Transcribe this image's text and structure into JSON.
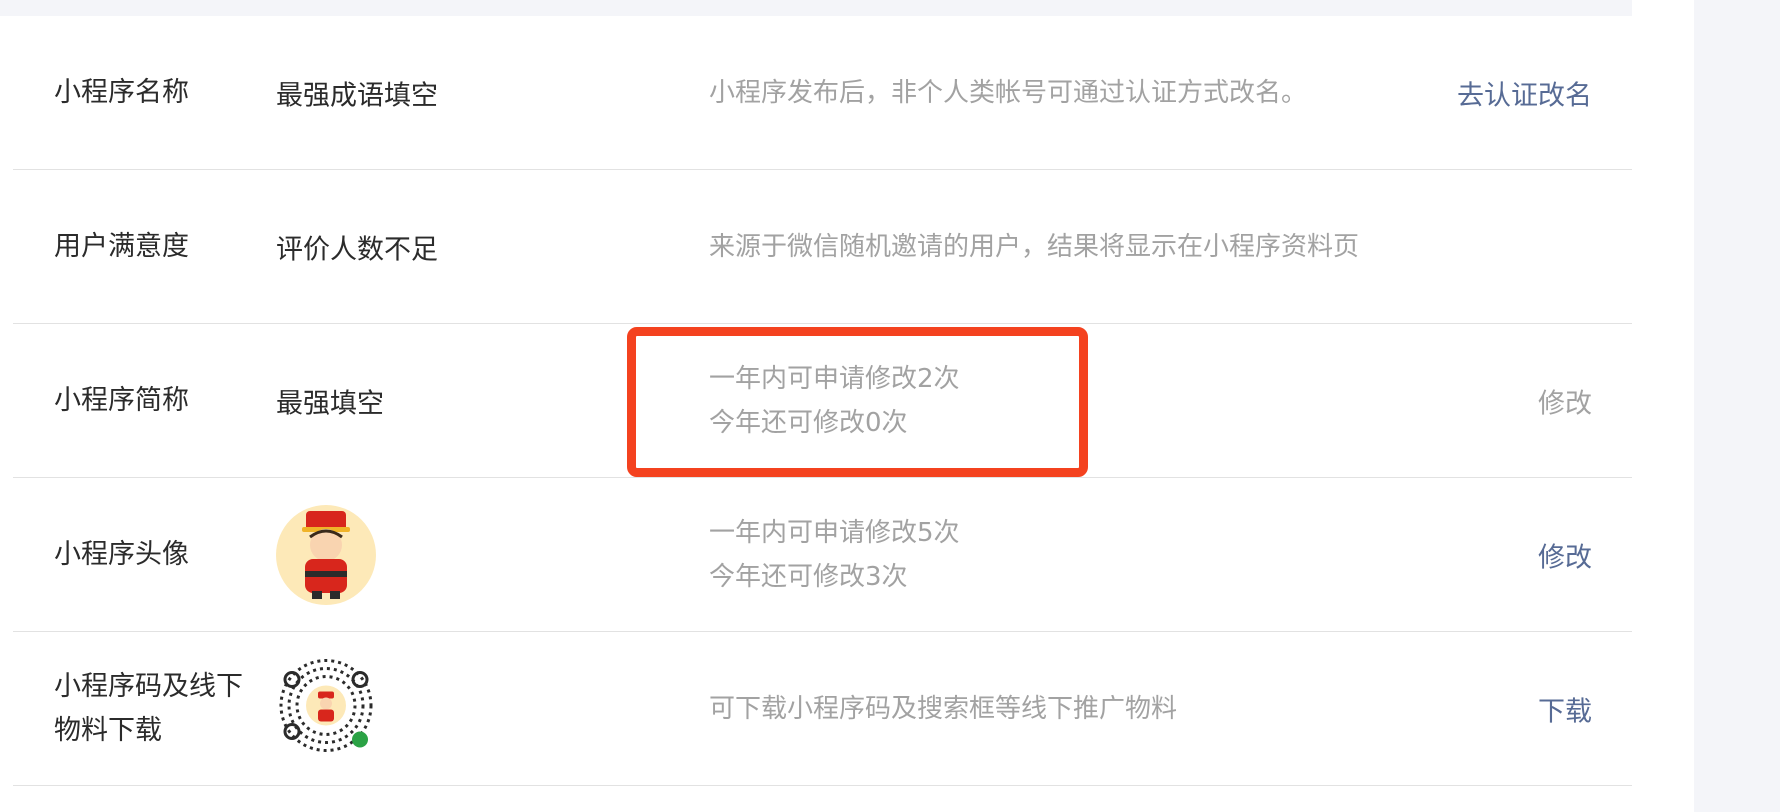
{
  "rows": [
    {
      "label": "小程序名称",
      "value": "最强成语填空",
      "desc": "小程序发布后，非个人类帐号可通过认证方式改名。",
      "action": "去认证改名"
    },
    {
      "label": "用户满意度",
      "value": "评价人数不足",
      "desc": "来源于微信随机邀请的用户，结果将显示在小程序资料页"
    },
    {
      "label": "小程序简称",
      "value": "最强填空",
      "desc_line1": "一年内可申请修改2次",
      "desc_line2": "今年还可修改0次",
      "action": "修改"
    },
    {
      "label": "小程序头像",
      "desc_line1": "一年内可申请修改5次",
      "desc_line2": "今年还可修改3次",
      "action": "修改"
    },
    {
      "label": "小程序码及线下物料下载",
      "desc": "可下载小程序码及搜索框等线下推广物料",
      "action": "下载"
    }
  ],
  "colors": {
    "accent": "#576b95",
    "highlight": "#f4421f",
    "muted": "#a2a2a2"
  }
}
